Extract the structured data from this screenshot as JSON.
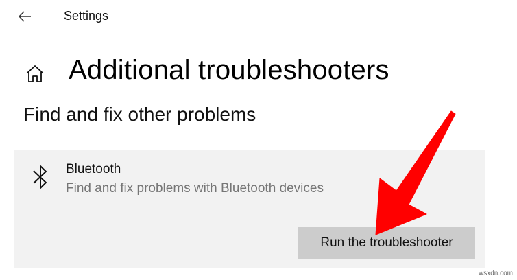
{
  "header": {
    "back_icon": "back-arrow-icon",
    "app_title": "Settings"
  },
  "page": {
    "home_icon": "home-icon",
    "title": "Additional troubleshooters",
    "section_title": "Find and fix other problems"
  },
  "troubleshooter": {
    "icon": "bluetooth-icon",
    "name": "Bluetooth",
    "description": "Find and fix problems with Bluetooth devices",
    "button_label": "Run the troubleshooter"
  },
  "annotation": {
    "arrow_color": "#ff0000"
  },
  "watermark": "wsxdn.com"
}
